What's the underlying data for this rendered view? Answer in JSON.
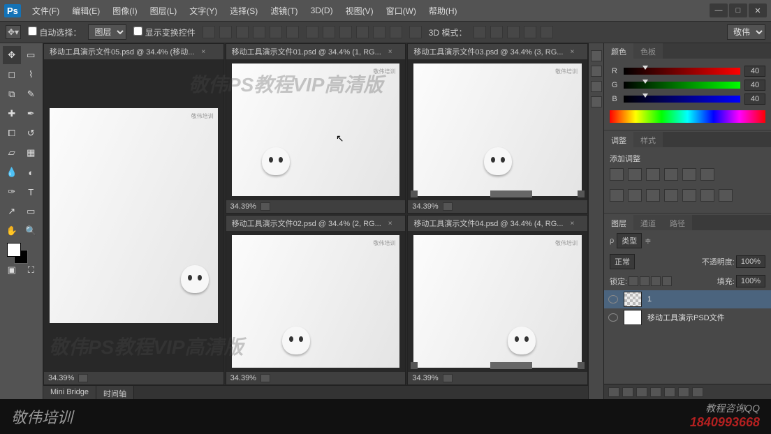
{
  "menu": {
    "items": [
      "文件(F)",
      "编辑(E)",
      "图像(I)",
      "图层(L)",
      "文字(Y)",
      "选择(S)",
      "滤镜(T)",
      "3D(D)",
      "视图(V)",
      "窗口(W)",
      "帮助(H)"
    ],
    "logo": "Ps"
  },
  "options": {
    "auto_select_label": "自动选择：",
    "auto_select_value": "图层",
    "show_transform_label": "显示变换控件",
    "mode3d_label": "3D 模式：",
    "workspace_dropdown": "敬伟"
  },
  "documents": [
    {
      "tab": "移动工具演示文件01.psd @ 34.4% (1, RG...",
      "zoom": "34.39%",
      "char": {
        "left": "18%",
        "bottom": "16%"
      }
    },
    {
      "tab": "移动工具演示文件03.psd @ 34.4% (3, RG...",
      "zoom": "34.39%",
      "char": {
        "left": "46%",
        "bottom": "16%"
      }
    },
    {
      "tab": "移动工具演示文件05.psd @ 34.4% (移动...",
      "zoom": "34.39%",
      "char": {
        "left": "78%",
        "bottom": "20%"
      }
    },
    {
      "tab": "移动工具演示文件02.psd @ 34.4% (2, RG...",
      "zoom": "34.39%",
      "char": {
        "left": "30%",
        "bottom": "10%"
      }
    },
    {
      "tab": "移动工具演示文件04.psd @ 34.4% (4, RG...",
      "zoom": "34.39%",
      "char": {
        "left": "60%",
        "bottom": "10%"
      }
    }
  ],
  "corner_brand": "敬伟培训",
  "bottom_tabs": [
    "Mini Bridge",
    "时间轴"
  ],
  "panels": {
    "color": {
      "tabs": [
        "颜色",
        "色板"
      ],
      "r_label": "R",
      "g_label": "G",
      "b_label": "B",
      "r": "40",
      "g": "40",
      "b": "40"
    },
    "adjust": {
      "tabs": [
        "调整",
        "样式"
      ],
      "add_label": "添加调整"
    },
    "layers": {
      "tabs": [
        "图层",
        "通道",
        "路径"
      ],
      "kind_label": "类型",
      "blend_mode": "正常",
      "opacity_label": "不透明度:",
      "opacity": "100%",
      "lock_label": "锁定:",
      "fill_label": "填充:",
      "fill": "100%",
      "items": [
        {
          "name": "1",
          "sel": true
        },
        {
          "name": "移动工具演示PSD文件",
          "sel": false
        }
      ]
    }
  },
  "branding": {
    "left": "敬伟培训",
    "right_label": "教程咨询QQ",
    "right_qq": "1840993668"
  },
  "watermark": "敬伟PS教程VIP高清版"
}
